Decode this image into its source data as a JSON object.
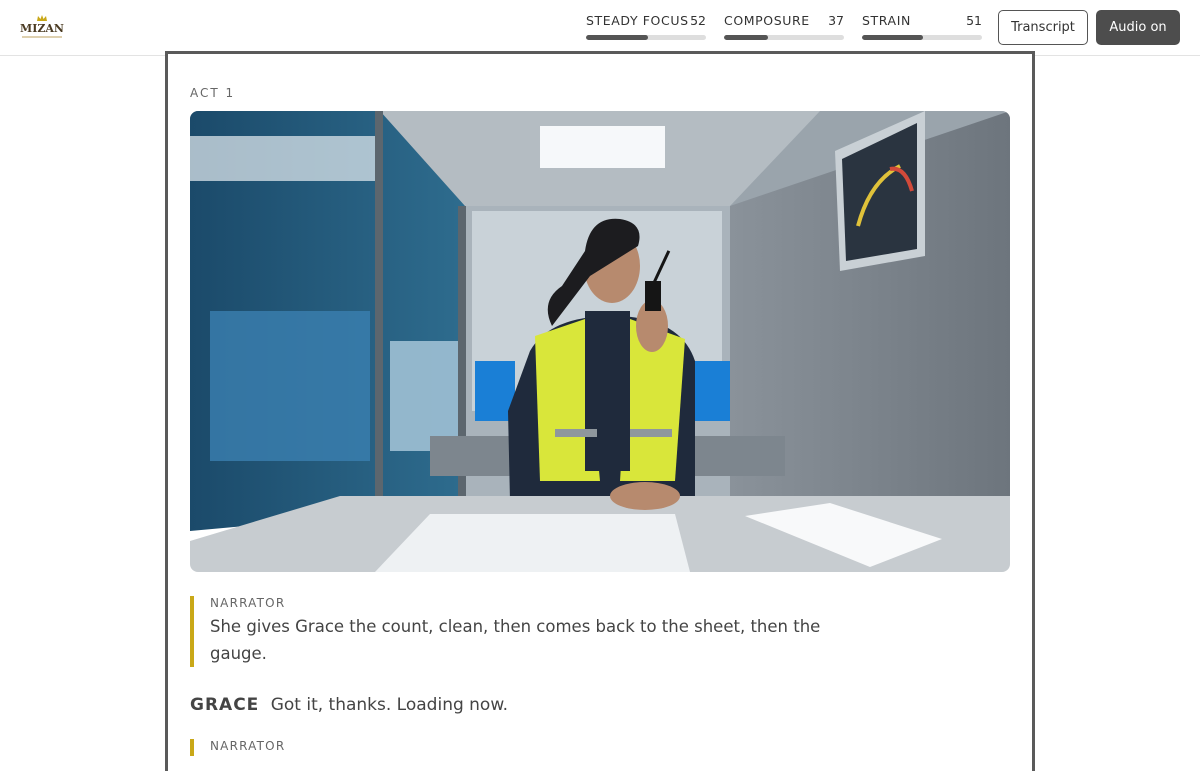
{
  "brand": {
    "name": "MIZAN"
  },
  "stats": [
    {
      "label": "STEADY FOCUS",
      "value": "52",
      "level": 0.52
    },
    {
      "label": "COMPOSURE",
      "value": "37",
      "level": 0.37
    },
    {
      "label": "STRAIN",
      "value": "51",
      "level": 0.51
    }
  ],
  "controls": {
    "transcript_label": "Transcript",
    "audio_label": "Audio on"
  },
  "story": {
    "act_label": "ACT 1",
    "blocks": [
      {
        "speaker": "NARRATOR",
        "text": "She gives Grace the count, clean, then comes back to the sheet, then the gauge."
      },
      {
        "speaker": "GRACE",
        "text": "Got it, thanks. Loading now."
      },
      {
        "speaker": "NARRATOR",
        "text": ""
      }
    ]
  },
  "colors": {
    "accent_bar": "#c9a818",
    "dark_button": "#4d4d4d",
    "panel_border": "#5a5a5a"
  }
}
